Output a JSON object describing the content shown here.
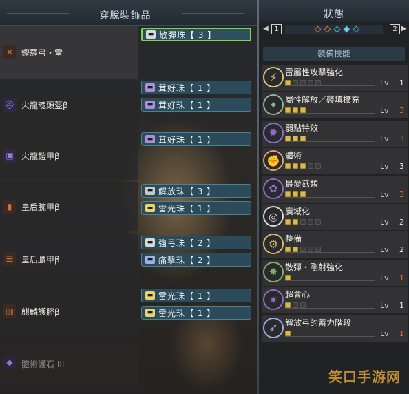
{
  "left_panel": {
    "title": "穿脫裝飾品",
    "equipment": [
      {
        "name": "鏗羅弓・雷",
        "icon": "bow-icon",
        "icon_color": "#b5522e",
        "slots": [
          {
            "label": "散彈珠【 3 】",
            "selected": true,
            "icon_color": "#d9d9d9"
          }
        ]
      },
      {
        "name": "火龍魂頭盔β",
        "icon": "helmet-icon",
        "icon_color": "#6a4fb8",
        "slots": [
          {
            "label": "茸好珠【 1 】",
            "selected": false,
            "icon_color": "#a88fd6"
          },
          {
            "label": "茸好珠【 1 】",
            "selected": false,
            "icon_color": "#a88fd6"
          }
        ]
      },
      {
        "name": "火龍鎧甲β",
        "icon": "chest-armor-icon",
        "icon_color": "#6a4fb8",
        "slots": [
          {
            "label": "茸好珠【 1 】",
            "selected": false,
            "icon_color": "#a88fd6"
          }
        ]
      },
      {
        "name": "皇后腕甲β",
        "icon": "gauntlet-icon",
        "icon_color": "#b5522e",
        "slots": [
          {
            "label": "解放珠【 3 】",
            "selected": false,
            "icon_color": "#c9c9c9"
          },
          {
            "label": "雷光珠【 1 】",
            "selected": false,
            "icon_color": "#e7d56a"
          }
        ]
      },
      {
        "name": "皇后腰甲β",
        "icon": "waist-armor-icon",
        "icon_color": "#b5522e",
        "slots": [
          {
            "label": "強弓珠【 2 】",
            "selected": false,
            "icon_color": "#d9d9d9"
          },
          {
            "label": "痛擊珠【 2 】",
            "selected": false,
            "icon_color": "#9fb2e6"
          }
        ]
      },
      {
        "name": "麒麟護脛β",
        "icon": "leg-armor-icon",
        "icon_color": "#b5522e",
        "slots": [
          {
            "label": "雷光珠【 1 】",
            "selected": false,
            "icon_color": "#e7d56a"
          },
          {
            "label": "雷光珠【 1 】",
            "selected": false,
            "icon_color": "#e7d56a"
          }
        ]
      },
      {
        "name": "體術護石 III",
        "icon": "charm-icon",
        "icon_color": "#6a5aa8",
        "slots": []
      }
    ]
  },
  "right_panel": {
    "title": "狀態",
    "page_left": "1",
    "page_right": "2",
    "section_label": "裝備技能",
    "lv_label": "Lv",
    "skills": [
      {
        "name": "雷屬性攻擊強化",
        "level": "1",
        "max": "5",
        "icon": "thunder-attack-icon",
        "icon_color": "#d9c37a"
      },
      {
        "name": "屬性解放／裝填擴充",
        "level": "3",
        "max": "3",
        "icon": "element-release-icon",
        "icon_color": "#8fb59a"
      },
      {
        "name": "弱點特效",
        "level": "3",
        "max": "3",
        "icon": "weakness-exploit-icon",
        "icon_color": "#8b6ec9"
      },
      {
        "name": "體術",
        "level": "3",
        "max": "5",
        "icon": "constitution-icon",
        "icon_color": "#d9a27a"
      },
      {
        "name": "最愛菇類",
        "level": "3",
        "max": "3",
        "icon": "mushroom-icon",
        "icon_color": "#8b6ec9"
      },
      {
        "name": "廣域化",
        "level": "2",
        "max": "5",
        "icon": "wide-range-icon",
        "icon_color": "#d9d9d9"
      },
      {
        "name": "整備",
        "level": "2",
        "max": "5",
        "icon": "maintenance-icon",
        "icon_color": "#d9b86e"
      },
      {
        "name": "散彈・剛射強化",
        "level": "1",
        "max": "1",
        "icon": "spread-shot-icon",
        "icon_color": "#7fae6a"
      },
      {
        "name": "超會心",
        "level": "1",
        "max": "3",
        "icon": "critical-boost-icon",
        "icon_color": "#8b6ec9"
      },
      {
        "name": "解放弓的蓄力階段",
        "level": "1",
        "max": "1",
        "icon": "bow-charge-icon",
        "icon_color": "#9fa8e0"
      }
    ]
  },
  "watermark": {
    "text": "笑口手游网"
  }
}
